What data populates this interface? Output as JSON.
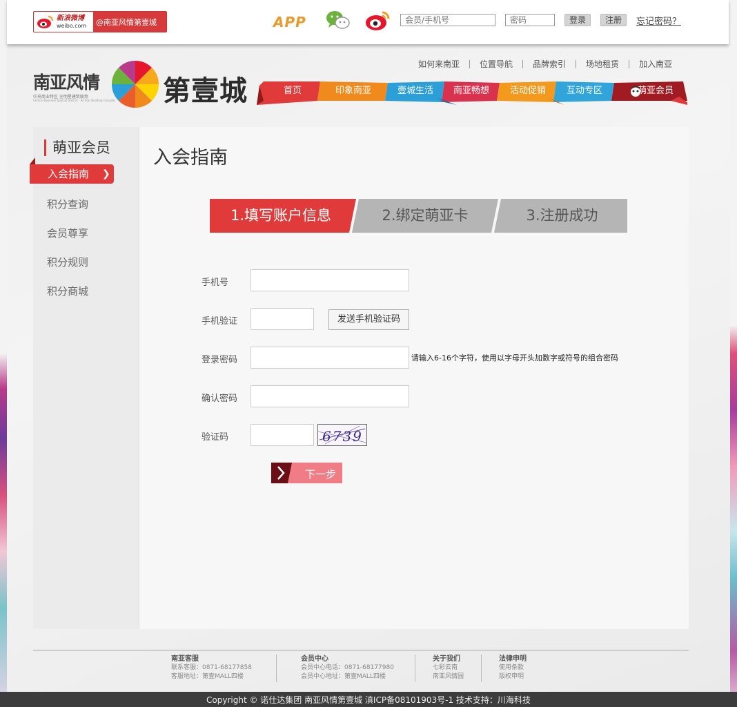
{
  "topbar": {
    "weibo_brand": "新浪微博",
    "weibo_domain": "weibo.com",
    "weibo_handle": "@南亚风情第壹城",
    "app_label": "APP",
    "account_placeholder": "会员/手机号",
    "password_placeholder": "密码",
    "login_label": "登录",
    "register_label": "注册",
    "forgot_label": "忘记密码？"
  },
  "header": {
    "logo_cn": "南亚风情",
    "logo_sub": "中央商业特区 全明星建筑联邦",
    "logo_sub_en": "Central Business Special District · All Star Building Complex",
    "logo_big": "第壹城",
    "top_links": [
      "如何来南亚",
      "位置导航",
      "品牌索引",
      "场地租赁",
      "加入南亚"
    ],
    "nav": [
      {
        "label": "首页",
        "color": "#e03a3a"
      },
      {
        "label": "印象南亚",
        "color": "#f08a1c"
      },
      {
        "label": "壹城生活",
        "color": "#2d9fd8"
      },
      {
        "label": "南亚畅想",
        "color": "#d9324e"
      },
      {
        "label": "活动促销",
        "color": "#f39a1e"
      },
      {
        "label": "互动专区",
        "color": "#31a4d9"
      },
      {
        "label": "萌亚会员",
        "color": "#a11c22"
      }
    ]
  },
  "sidebar": {
    "title": "萌亚会员",
    "active_item": "入会指南",
    "items": [
      "积分查询",
      "会员尊享",
      "积分规则",
      "积分商城"
    ]
  },
  "main": {
    "title": "入会指南",
    "steps": [
      "1.填写账户信息",
      "2.绑定萌亚卡",
      "3.注册成功"
    ],
    "form": {
      "phone_label": "手机号",
      "sms_label": "手机验证",
      "sms_button": "发送手机验证码",
      "password_label": "登录密码",
      "password_hint": "请输入6-16个字符，使用以字母开头加数字或符号的组合密码",
      "confirm_label": "确认密码",
      "captcha_label": "验证码",
      "captcha_text": "6739",
      "next_button": "下一步"
    }
  },
  "footer": {
    "columns": [
      {
        "heading": "南亚客服",
        "lines": [
          "联系客服：0871-68177858",
          "客服地址：第壹MALL四楼"
        ]
      },
      {
        "heading": "会员中心",
        "lines": [
          "会员中心电话：0871-68177980",
          "会员中心地址：第壹MALL四楼"
        ]
      },
      {
        "heading": "关于我们",
        "lines": [
          "七彩云南",
          "南亚风情园"
        ]
      },
      {
        "heading": "法律申明",
        "lines": [
          "使用条款",
          "版权申明"
        ]
      }
    ],
    "copyright": "Copyright © 诺仕达集团 南亚风情第壹城 滇ICP备08101903号-1 技术支持：川海科技"
  },
  "colors": {
    "accent": "#e03a3a",
    "step_active": "#e03a3a",
    "step_inactive": "#b5b5b5",
    "next_button": "#f07d86"
  }
}
